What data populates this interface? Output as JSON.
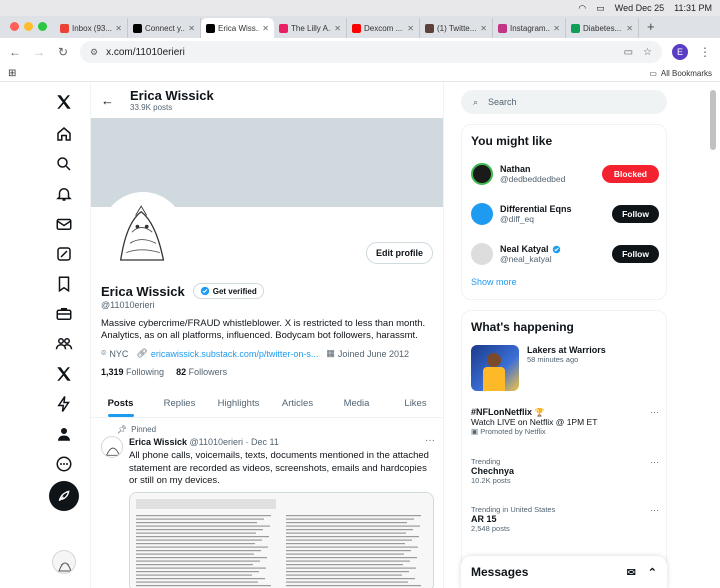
{
  "system": {
    "date": "Wed Dec 25",
    "time": "11:31 PM"
  },
  "browser": {
    "tabs": [
      {
        "label": "Inbox (93...",
        "color": "#ea4335"
      },
      {
        "label": "Connect y...",
        "color": "#000000"
      },
      {
        "label": "Erica Wiss...",
        "color": "#000000",
        "active": true
      },
      {
        "label": "The Lilly A...",
        "color": "#e91e63"
      },
      {
        "label": "Dexcom ...",
        "color": "#ff0000"
      },
      {
        "label": "(1) Twitte...",
        "color": "#5d4037"
      },
      {
        "label": "Instagram...",
        "color": "#c13584"
      },
      {
        "label": "Diabetes...",
        "color": "#0f9d58"
      }
    ],
    "url": "x.com/11010erieri",
    "profile_initial": "E",
    "bookmarks_label": "All Bookmarks"
  },
  "profile": {
    "header_name": "Erica Wissick",
    "posts_count": "33.9K posts",
    "edit_label": "Edit profile",
    "name": "Erica Wissick",
    "get_verified": "Get verified",
    "handle": "@11010erieri",
    "bio": "Massive cybercrime/FRAUD whistleblower. X is restricted to less than month. Analytics, as on all platforms, influenced. Bodycam bot followers, harassmt.",
    "location": "NYC",
    "link": "ericawissick.substack.com/p/twitter-on-s...",
    "joined": "Joined June 2012",
    "following_count": "1,319",
    "following_label": "Following",
    "followers_count": "82",
    "followers_label": "Followers",
    "tabs": [
      "Posts",
      "Replies",
      "Highlights",
      "Articles",
      "Media",
      "Likes"
    ]
  },
  "post": {
    "pinned_label": "Pinned",
    "author": "Erica Wissick",
    "handle_date": "@11010erieri · Dec 11",
    "text": "All phone calls, voicemails, texts, documents mentioned in the attached statement are recorded as videos, screenshots, emails and hardcopies or still on my devices."
  },
  "sidebar": {
    "search_placeholder": "Search",
    "you_might_like": "You might like",
    "suggestions": [
      {
        "name": "Nathan",
        "handle": "@dedbeddedbed",
        "button": "Blocked",
        "verified": false
      },
      {
        "name": "Differential Eqns",
        "handle": "@diff_eq",
        "button": "Follow",
        "verified": false
      },
      {
        "name": "Neal Katyal",
        "handle": "@neal_katyal",
        "button": "Follow",
        "verified": true
      }
    ],
    "show_more": "Show more",
    "whats_happening": "What's happening",
    "featured": {
      "title": "Lakers at Warriors",
      "time": "58 minutes ago"
    },
    "promo": {
      "title": "#NFLonNetflix",
      "line": "Watch LIVE on Netflix @ 1PM ET",
      "promoted": "Promoted by Netflix"
    },
    "trends": [
      {
        "category": "Trending",
        "title": "Chechnya",
        "count": "10.2K posts"
      },
      {
        "category": "Trending in United States",
        "title": "AR 15",
        "count": "2,548 posts"
      }
    ],
    "messages": "Messages"
  }
}
